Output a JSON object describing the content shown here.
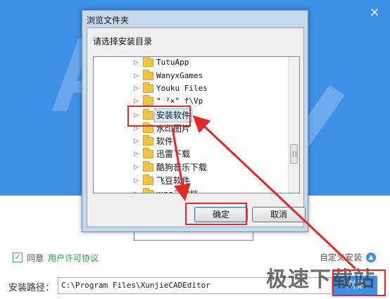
{
  "dialog": {
    "title": "浏览文件夹",
    "prompt": "请选择安装目录",
    "tree": [
      {
        "label": "TutuApp",
        "zh": false
      },
      {
        "label": "WanyxGames",
        "zh": false
      },
      {
        "label": "Youku Files",
        "zh": false
      },
      {
        "label": "° ²×° f\\Vp",
        "zh": false
      },
      {
        "label": "安装软件",
        "zh": true,
        "selected": true
      },
      {
        "label": "水印图片",
        "zh": true
      },
      {
        "label": "软件",
        "zh": true
      },
      {
        "label": "迅雷下载",
        "zh": true
      },
      {
        "label": "酷狗音乐下载",
        "zh": true
      },
      {
        "label": "飞豆软件",
        "zh": true
      },
      {
        "label": "wps云文档",
        "zh": true
      }
    ],
    "ok_label": "确定",
    "cancel_label": "取消"
  },
  "installer": {
    "close_icon": "×",
    "agree_text": "同意",
    "license_link": "用户许可协议",
    "custom_install": "自定义安装",
    "path_label": "安装路径：",
    "path_value": "C:\\Program Files\\XunjieCADEditor",
    "browse_label": "浏览"
  },
  "watermark": "极速下载站",
  "colors": {
    "accent": "#3e8fe6",
    "annotation": "#e8262a",
    "link": "#2e9e48"
  }
}
